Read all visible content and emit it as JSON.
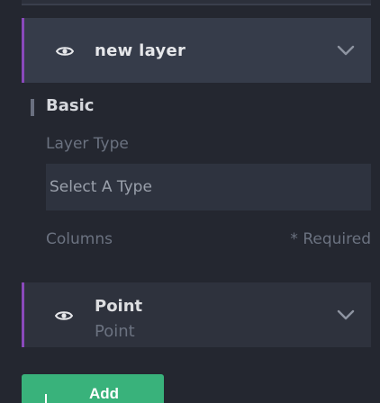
{
  "layer": {
    "name": "new layer",
    "section_title": "Basic",
    "layer_type_label": "Layer Type",
    "type_select": {
      "value": "Select A Type"
    },
    "columns_label": "Columns",
    "required_label": "* Required",
    "column_field": {
      "title": "Point",
      "subtitle": "Point"
    },
    "add_button_label": "Add"
  },
  "colors": {
    "accent": "#8a49bb",
    "add_button": "#39b27b",
    "background": "#242730",
    "panel": "#363c4a"
  },
  "icons": {
    "visibility": "eye-icon",
    "expand": "chevron-down-icon",
    "add": "plus-icon"
  }
}
